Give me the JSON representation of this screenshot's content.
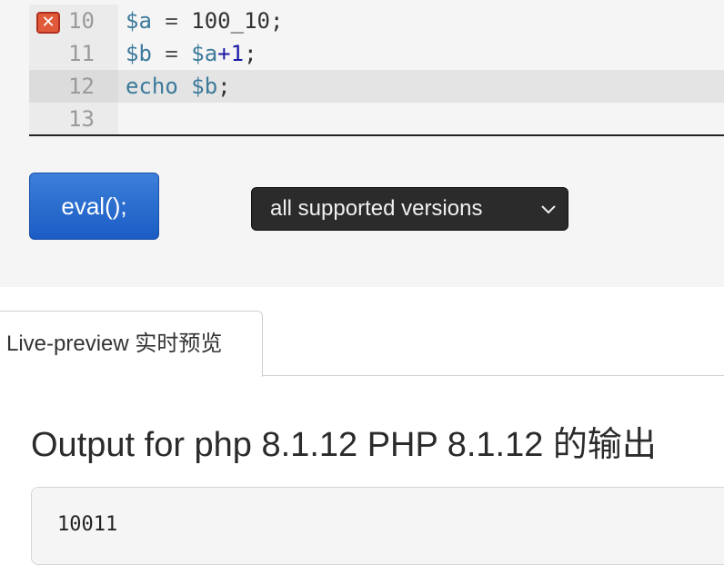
{
  "editor": {
    "lines": [
      {
        "number": "10",
        "has_error": true,
        "tokens": [
          {
            "t": "$a",
            "k": "var"
          },
          {
            "t": " = ",
            "k": "op"
          },
          {
            "t": "100_10",
            "k": "num"
          },
          {
            "t": ";",
            "k": "plain"
          }
        ]
      },
      {
        "number": "11",
        "has_error": false,
        "tokens": [
          {
            "t": "$b",
            "k": "var"
          },
          {
            "t": " = ",
            "k": "op"
          },
          {
            "t": "$a",
            "k": "var"
          },
          {
            "t": "+1",
            "k": "blue"
          },
          {
            "t": ";",
            "k": "plain"
          }
        ]
      },
      {
        "number": "12",
        "active": true,
        "has_error": false,
        "tokens": [
          {
            "t": "echo ",
            "k": "kw"
          },
          {
            "t": "$b",
            "k": "var"
          },
          {
            "t": ";",
            "k": "plain"
          }
        ]
      },
      {
        "number": "13",
        "has_error": false,
        "tokens": []
      }
    ],
    "error_icon": "error-x-icon"
  },
  "controls": {
    "eval_label": "eval();",
    "version_select": {
      "selected": "all supported versions",
      "chevron_icon": "chevron-down-icon"
    }
  },
  "tabs": {
    "live_preview_label": "Live-preview 实时预览"
  },
  "output": {
    "title": "Output for php 8.1.12 PHP 8.1.12 的输出",
    "result": "10011"
  },
  "colors": {
    "eval_button": "#2a6fd0",
    "select_bg": "#2b2b2b",
    "error_marker": "#e05a3a",
    "panel_bg": "#f5f5f5"
  }
}
